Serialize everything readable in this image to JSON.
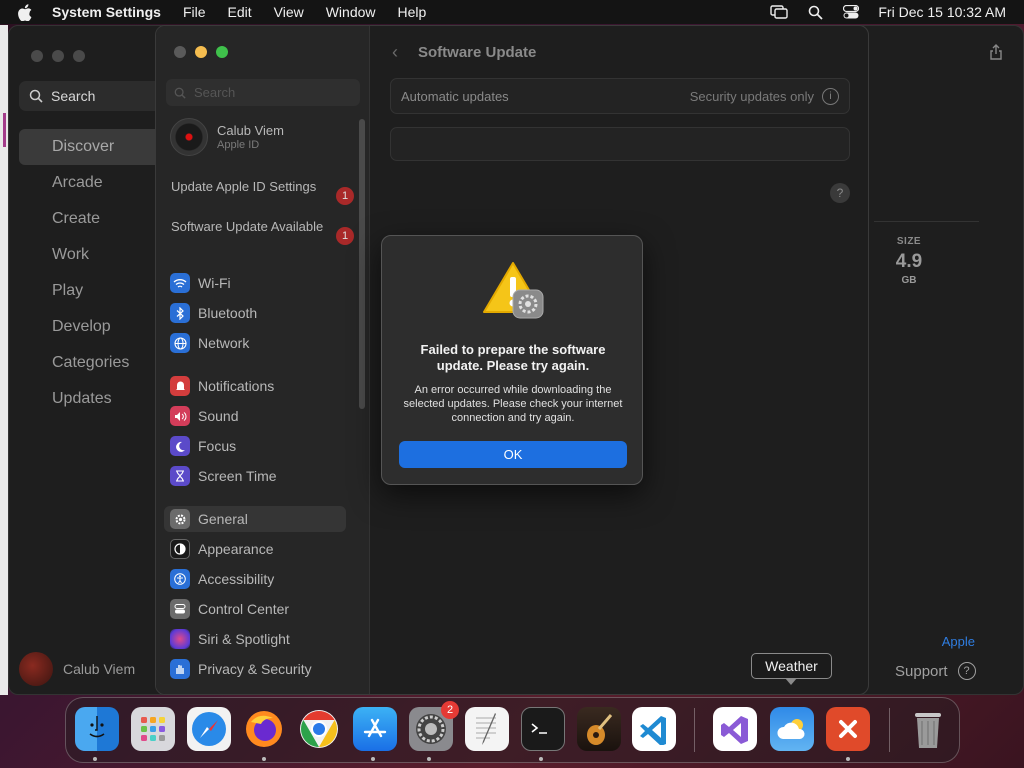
{
  "menubar": {
    "app_name": "System Settings",
    "items": [
      "File",
      "Edit",
      "View",
      "Window",
      "Help"
    ],
    "clock": "Fri Dec 15  10:32 AM"
  },
  "appstore": {
    "search_label": "Search",
    "nav": [
      "Discover",
      "Arcade",
      "Create",
      "Work",
      "Play",
      "Develop",
      "Categories",
      "Updates"
    ],
    "active_nav": "Discover",
    "user_name": "Calub Viem",
    "size_label": "SIZE",
    "size_value": "4.9",
    "size_unit": "GB",
    "developer": "Apple",
    "support_label": "Support"
  },
  "settings": {
    "search_placeholder": "Search",
    "account_name": "Calub Viem",
    "account_sub": "Apple ID",
    "notices": [
      {
        "label": "Update Apple ID Settings",
        "badge": "1"
      },
      {
        "label": "Software Update Available",
        "badge": "1"
      }
    ],
    "groups": {
      "network": [
        "Wi-Fi",
        "Bluetooth",
        "Network"
      ],
      "notifications": [
        "Notifications",
        "Sound",
        "Focus",
        "Screen Time"
      ],
      "system": [
        "General",
        "Appearance",
        "Accessibility",
        "Control Center",
        "Siri & Spotlight",
        "Privacy & Security"
      ]
    },
    "selected": "General",
    "page_title": "Software Update",
    "auto_updates_label": "Automatic updates",
    "auto_updates_value": "Security updates only",
    "help_label": "?"
  },
  "dialog": {
    "title": "Failed to prepare the software update. Please try again.",
    "message": "An error occurred while downloading the selected updates. Please check your internet connection and try again.",
    "ok_label": "OK"
  },
  "tooltip": "Weather",
  "dock": {
    "apps": [
      "finder-icon",
      "launchpad-icon",
      "safari-icon",
      "firefox-icon",
      "chrome-icon",
      "app-store-icon",
      "system-settings-icon",
      "textedit-icon",
      "terminal-icon",
      "garageband-icon",
      "vscode-icon",
      "visual-studio-icon",
      "weather-icon",
      "remote-desktop-icon",
      "trash-icon"
    ],
    "settings_badge": "2"
  },
  "colors": {
    "accent": "#1d6fe0",
    "badge": "#c02a2a",
    "link": "#2f7de1"
  }
}
